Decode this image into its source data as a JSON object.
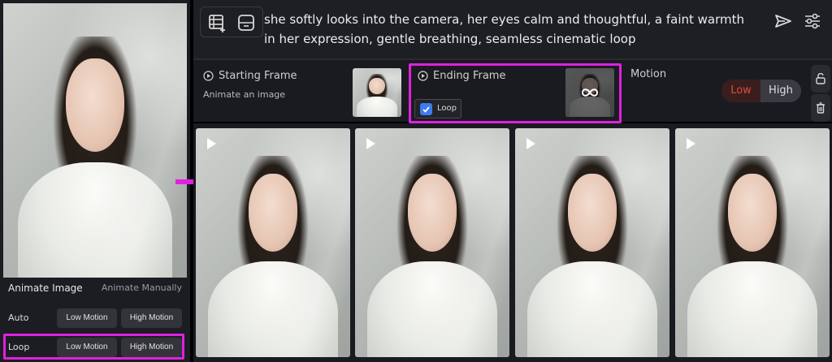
{
  "prompt": {
    "text": "she softly looks into the camera, her eyes calm and thoughtful, a faint warmth in her expression, gentle breathing, seamless cinematic loop"
  },
  "left_panel": {
    "title": "Animate Image",
    "manual": "Animate Manually",
    "rows": [
      {
        "label": "Auto",
        "low": "Low Motion",
        "high": "High Motion"
      },
      {
        "label": "Loop",
        "low": "Low Motion",
        "high": "High Motion"
      }
    ]
  },
  "starting_frame": {
    "title": "Starting Frame",
    "subtitle": "Animate an image"
  },
  "ending_frame": {
    "title": "Ending Frame",
    "loop_label": "Loop",
    "loop_checked": true
  },
  "motion": {
    "title": "Motion",
    "low": "Low",
    "high": "High",
    "selected": "Low"
  },
  "icons": {
    "add_frame": "film-plus-icon",
    "gallery": "frame-icon",
    "send": "send-icon",
    "settings": "sliders-icon",
    "lock": "unlock-icon",
    "delete": "trash-icon",
    "loop": "infinity-icon",
    "play": "play-icon"
  },
  "colors": {
    "highlight": "#e020e0",
    "accent_low": "#e24a3b",
    "checkbox": "#3d7cf0"
  }
}
